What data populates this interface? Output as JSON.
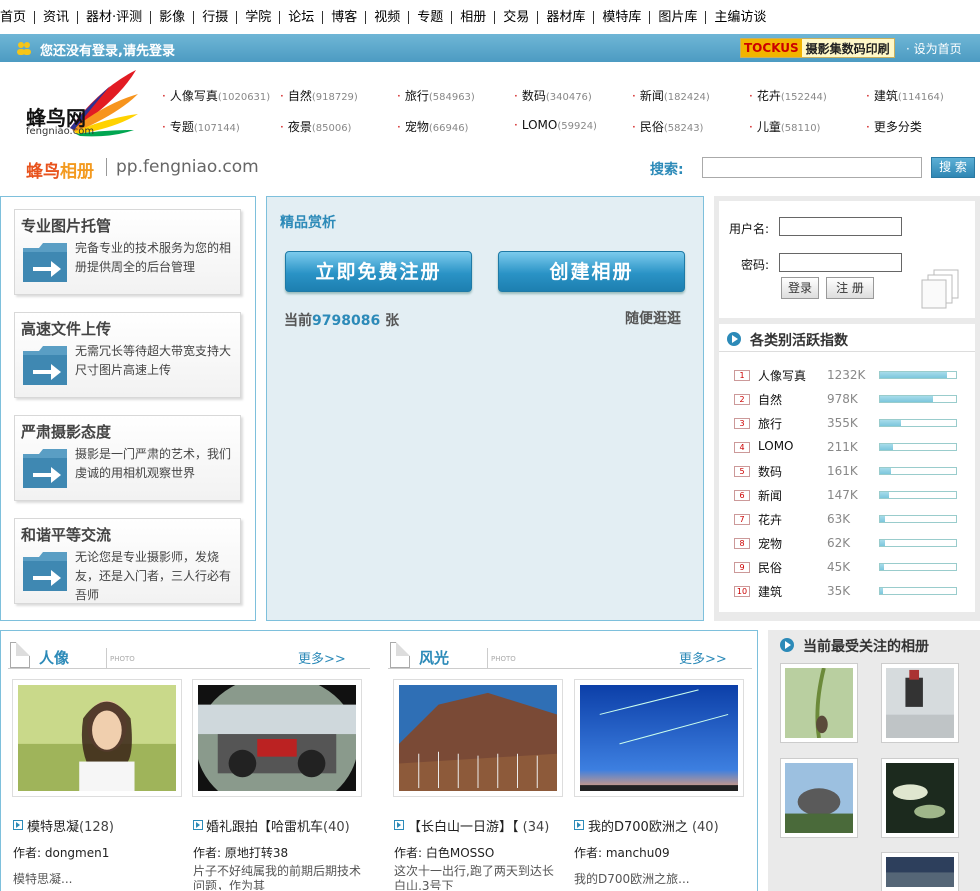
{
  "topnav": [
    "首页",
    "资讯",
    "器材·评测",
    "影像",
    "行摄",
    "学院",
    "论坛",
    "博客",
    "视频",
    "专题",
    "相册",
    "交易",
    "器材库",
    "模特库",
    "图片库",
    "主编访谈"
  ],
  "loginbar": {
    "message": "您还没有登录,请先登录",
    "promo_brand": "TOCKUS",
    "promo_text": "摄影集数码印刷",
    "home_link": "· 设为首页"
  },
  "logo": {
    "name": "蜂鸟网",
    "domain": "fengniao.com"
  },
  "categories": [
    {
      "name": "人像写真",
      "count": "(1020631)"
    },
    {
      "name": "自然",
      "count": "(918729)"
    },
    {
      "name": "旅行",
      "count": "(584963)"
    },
    {
      "name": "数码",
      "count": "(340476)"
    },
    {
      "name": "新闻",
      "count": "(182424)"
    },
    {
      "name": "花卉",
      "count": "(152244)"
    },
    {
      "name": "建筑",
      "count": "(114164)"
    },
    {
      "name": "专题",
      "count": "(107144)"
    },
    {
      "name": "夜景",
      "count": "(85006)"
    },
    {
      "name": "宠物",
      "count": "(66946)"
    },
    {
      "name": "LOMO",
      "count": "(59924)"
    },
    {
      "name": "民俗",
      "count": "(58243)"
    },
    {
      "name": "儿童",
      "count": "(58110)"
    },
    {
      "name": "更多分类",
      "count": ""
    }
  ],
  "album_bar": {
    "logo_a": "蜂鸟",
    "logo_b": "相册",
    "url": "pp.fengniao.com",
    "search_label": "搜索:",
    "search_button": "搜 索"
  },
  "features": [
    {
      "title": "专业图片托管",
      "desc": "完备专业的技术服务为您的相册提供周全的后台管理"
    },
    {
      "title": "高速文件上传",
      "desc": "无需冗长等待超大带宽支持大尺寸图片高速上传"
    },
    {
      "title": "严肃摄影态度",
      "desc": "摄影是一门严肃的艺术，我们虔诚的用相机观察世界"
    },
    {
      "title": "和谐平等交流",
      "desc": "无论您是专业摄影师，发烧友，还是入门者，三人行必有吾师"
    }
  ],
  "middle": {
    "title": "精品赏析",
    "register_button": "立即免费注册",
    "create_button": "创建相册",
    "count_prefix": "当前",
    "count_value": "9798086",
    "count_suffix": "张",
    "random_link": "随便逛逛"
  },
  "login": {
    "username_label": "用户名:",
    "password_label": "密码:",
    "login_button": "登录",
    "register_button": "注 册"
  },
  "ranking": {
    "title": "各类别活跃指数",
    "rows": [
      {
        "idx": "1",
        "name": "人像写真",
        "value": "1232K",
        "fill": 0.88
      },
      {
        "idx": "2",
        "name": "自然",
        "value": "978K",
        "fill": 0.7
      },
      {
        "idx": "3",
        "name": "旅行",
        "value": "355K",
        "fill": 0.28
      },
      {
        "idx": "4",
        "name": "LOMO",
        "value": "211K",
        "fill": 0.17
      },
      {
        "idx": "5",
        "name": "数码",
        "value": "161K",
        "fill": 0.14
      },
      {
        "idx": "6",
        "name": "新闻",
        "value": "147K",
        "fill": 0.12
      },
      {
        "idx": "7",
        "name": "花卉",
        "value": "63K",
        "fill": 0.06
      },
      {
        "idx": "8",
        "name": "宠物",
        "value": "62K",
        "fill": 0.06
      },
      {
        "idx": "9",
        "name": "民俗",
        "value": "45K",
        "fill": 0.05
      },
      {
        "idx": "10",
        "name": "建筑",
        "value": "35K",
        "fill": 0.04
      }
    ]
  },
  "sections": [
    {
      "title": "人像",
      "photo_tag": "PHOTO",
      "more": "更多>>",
      "albums": [
        {
          "title": "模特思凝",
          "count": "(128)",
          "author": "作者: dongmen1",
          "snippet": "模特思凝..."
        },
        {
          "title": "婚礼跟拍【哈雷机车",
          "count": "(40)",
          "author": "作者: 原地打转38",
          "snippet": "片子不好纯属我的前期后期技术问题，作为其"
        }
      ]
    },
    {
      "title": "风光",
      "photo_tag": "PHOTO",
      "more": "更多>>",
      "albums": [
        {
          "title": "【长白山一日游】【",
          "count": "(34)",
          "author": "作者: 白色MOSSO",
          "snippet": "这次十一出行,跑了两天到达长白山,3号下"
        },
        {
          "title": "我的D700欧洲之",
          "count": "(40)",
          "author": "作者: manchu09",
          "snippet": "我的D700欧洲之旅..."
        }
      ]
    }
  ],
  "hot": {
    "title": "当前最受关注的相册"
  }
}
